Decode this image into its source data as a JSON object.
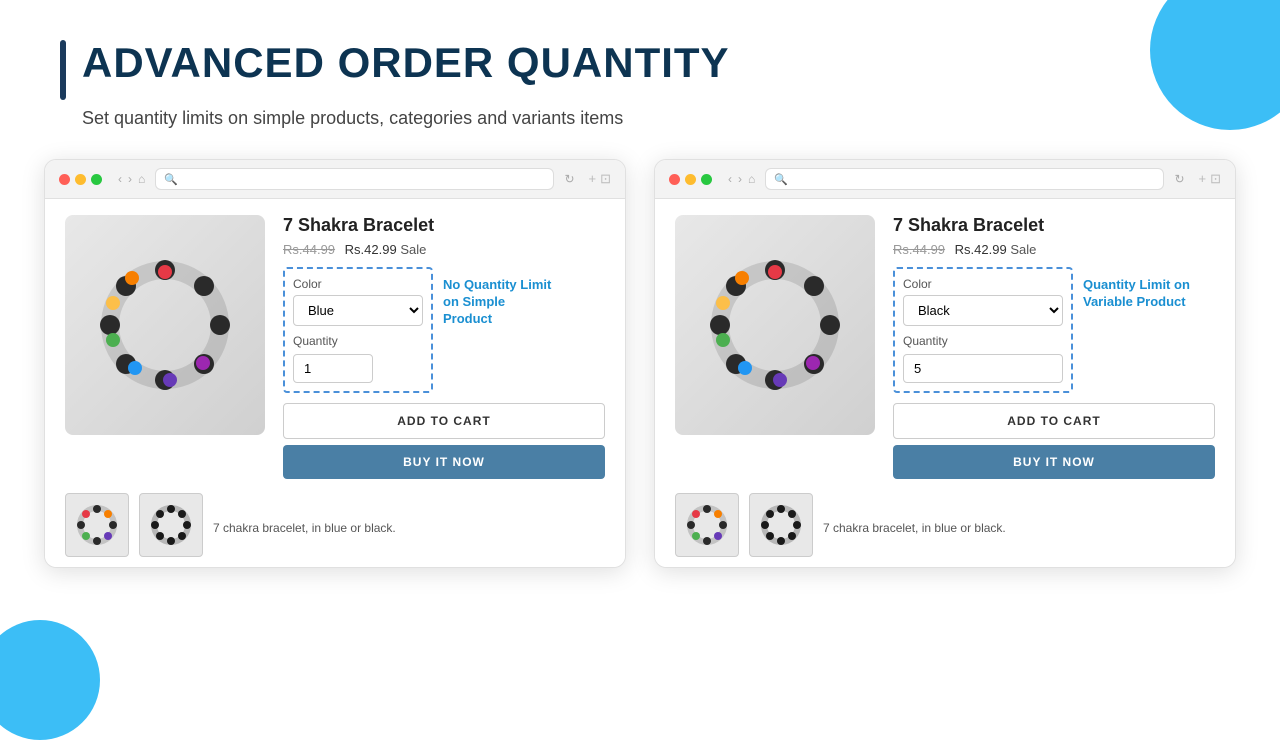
{
  "header": {
    "title": "ADVANCED ORDER QUANTITY",
    "subtitle": "Set quantity limits on simple products, categories and variants items"
  },
  "browser1": {
    "product": {
      "name": "7 Shakra Bracelet",
      "price_original": "Rs.44.99",
      "price_sale": "Rs.42.99",
      "price_label": "Sale",
      "color_label": "Color",
      "color_value": "Blue",
      "color_options": [
        "Blue",
        "Black"
      ],
      "quantity_label": "Quantity",
      "quantity_value": "1",
      "annotation": "No Quantity Limit on Simple Product",
      "btn_add_cart": "ADD TO CART",
      "btn_buy_now": "BUY IT NOW",
      "description": "7 chakra bracelet, in blue or black."
    }
  },
  "browser2": {
    "product": {
      "name": "7 Shakra Bracelet",
      "price_original": "Rs.44.99",
      "price_sale": "Rs.42.99",
      "price_label": "Sale",
      "color_label": "Color",
      "color_value": "Black",
      "color_options": [
        "Blue",
        "Black"
      ],
      "quantity_label": "Quantity",
      "quantity_value": "5",
      "annotation": "Quantity Limit on Variable Product",
      "btn_add_cart": "ADD TO CART",
      "btn_buy_now": "BUY IT NOW",
      "description": "7 chakra bracelet, in blue or black."
    }
  }
}
